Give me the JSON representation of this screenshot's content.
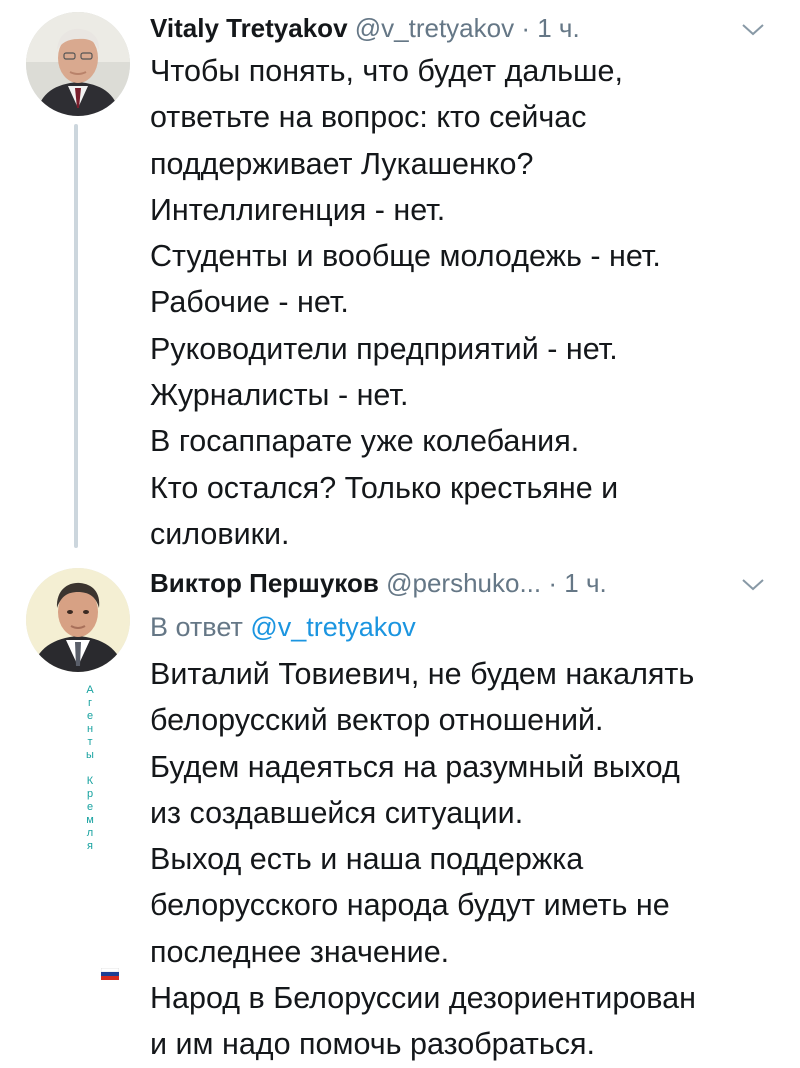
{
  "tweet1": {
    "display_name": "Vitaly Tretyakov",
    "handle": "@v_tretyakov",
    "separator": "·",
    "time": "1 ч.",
    "lines": [
      "Чтобы понять, что будет дальше,",
      "ответьте на вопрос: кто сейчас",
      "поддерживает Лукашенко?",
      "Интеллигенция - нет.",
      "Студенты и вообще молодежь - нет.",
      "Рабочие - нет.",
      "Руководители предприятий - нет.",
      "Журналисты - нет.",
      "В госаппарате уже колебания.",
      "Кто остался? Только крестьяне и",
      "силовики."
    ]
  },
  "tweet2": {
    "display_name": "Виктор Першуков",
    "handle": "@pershuko...",
    "separator": "·",
    "time": "1 ч.",
    "reply_prefix": "В ответ",
    "reply_handle": "@v_tretyakov",
    "lines": [
      "Виталий Товиевич, не будем накалять",
      "белорусский вектор отношений.",
      "Будем надеяться на разумный выход",
      "из создавшейся ситуации.",
      "Выход есть и наша поддержка",
      "белорусского народа будут иметь не",
      "последнее значение.",
      "Народ в Белоруссии дезориентирован",
      "и им надо помочь разобраться."
    ]
  },
  "badge": {
    "letters": [
      "А",
      "г",
      "е",
      "н",
      "т",
      "ы",
      "",
      "К",
      "р",
      "е",
      "м",
      "л",
      "я"
    ],
    "flag_colors": [
      "#ffffff",
      "#1c3f94",
      "#d52b1e"
    ]
  },
  "colors": {
    "text": "#14171a",
    "secondary": "#657786",
    "link": "#1b95e0",
    "thread_line": "#ccd6dd",
    "badge_text": "#17a2a0"
  },
  "icons": [
    "chevron-down-icon",
    "avatar-vitaly",
    "avatar-viktor",
    "russian-flag-icon"
  ]
}
